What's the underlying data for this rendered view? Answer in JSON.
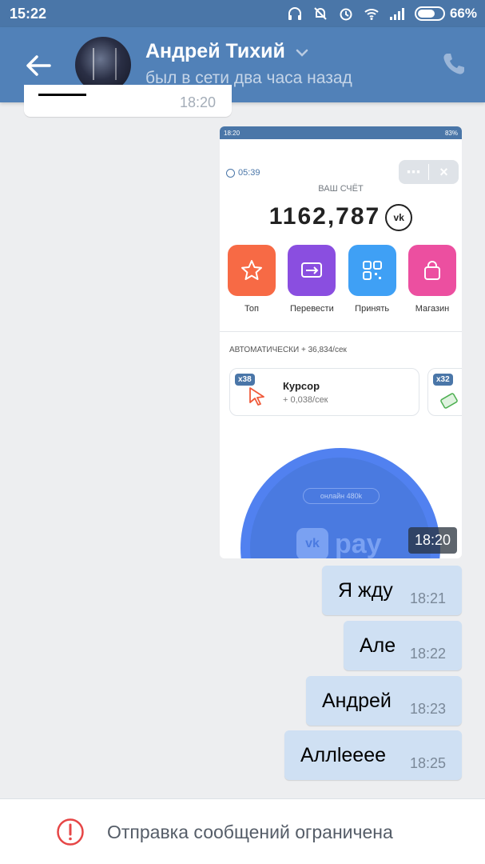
{
  "status_bar": {
    "time": "15:22",
    "battery": "66%"
  },
  "header": {
    "name": "Андрей Тихий",
    "last_seen": "был в сети два часа назад"
  },
  "partial_message": {
    "time": "18:20"
  },
  "image_message": {
    "time": "18:20",
    "inner_status_time": "18:20",
    "inner_battery": "83%",
    "timer": "05:39",
    "balance_label": "ВАШ СЧЁТ",
    "balance": "1162,787",
    "actions": [
      {
        "label": "Топ",
        "color": "#f76a45"
      },
      {
        "label": "Перевести",
        "color": "#8a4ee0"
      },
      {
        "label": "Принять",
        "color": "#3fa0f5"
      },
      {
        "label": "Магазин",
        "color": "#ec4fa0"
      }
    ],
    "auto_label": "АВТОМАТИЧЕСКИ + 36,834/сек",
    "card1": {
      "badge": "x38",
      "title": "Курсор",
      "sub": "+ 0,038/сек"
    },
    "card2": {
      "badge": "x32"
    },
    "online": "онлайн 480k",
    "pay_text": "pay"
  },
  "messages": [
    {
      "text": "Я жду",
      "time": "18:21"
    },
    {
      "text": "Але",
      "time": "18:22"
    },
    {
      "text": "Андрей",
      "time": "18:23"
    },
    {
      "text": "Аллleeee",
      "time": "18:25"
    }
  ],
  "bottom": {
    "warning": "Отправка сообщений ограничена"
  },
  "colors": {
    "header": "#5181b8",
    "status_bar": "#4a76a8",
    "outgoing_bubble": "#cfe0f3",
    "warning": "#e64646"
  }
}
